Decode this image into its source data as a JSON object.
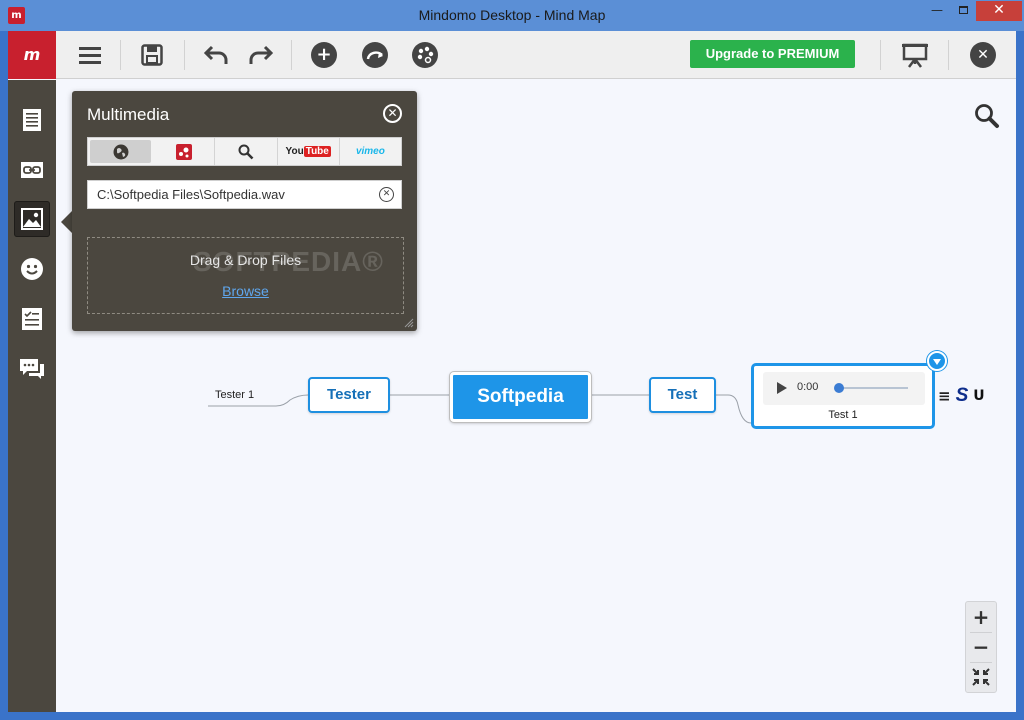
{
  "window": {
    "title": "Mindomo Desktop - Mind Map",
    "minimize": "—",
    "close": "✕"
  },
  "toolbar": {
    "brand_label": "m",
    "upgrade_label": "Upgrade to PREMIUM",
    "buttons": [
      "menu-icon",
      "save-icon",
      "undo-icon",
      "redo-icon",
      "add-topic-icon",
      "relationship-icon",
      "palette-icon",
      "presentation-icon",
      "close-map-icon"
    ],
    "add_label": "+",
    "close_label": "✕"
  },
  "sidebar": {
    "items": [
      "notes-icon",
      "link-icon",
      "image-icon",
      "emoji-icon",
      "tasks-icon",
      "comments-icon"
    ],
    "active": "image-icon"
  },
  "multimedia": {
    "title": "Multimedia",
    "close_label": "✕",
    "tabs": [
      {
        "name": "web-icon",
        "label": ""
      },
      {
        "name": "mindomo-icon",
        "label": ""
      },
      {
        "name": "search-icon",
        "label": ""
      },
      {
        "name": "youtube",
        "label_you": "You",
        "label_tube": "Tube"
      },
      {
        "name": "vimeo",
        "label": "vimeo"
      }
    ],
    "path_value": "C:\\Softpedia Files\\Softpedia.wav",
    "clear_label": "✕",
    "drop_text": "Drag & Drop Files",
    "browse_label": "Browse",
    "watermark": "SOFTPEDIA®"
  },
  "mindmap": {
    "central": "Softpedia",
    "left_child": "Tester",
    "left_leaf": "Tester 1",
    "right_child": "Test",
    "media_time": "0:00",
    "media_label": "Test 1",
    "extras": {
      "notes": "≡",
      "skype": "S",
      "link": "ᑌ"
    }
  },
  "zoom": {
    "in": "+",
    "out": "−",
    "fit": "⤡"
  },
  "colors": {
    "accent": "#1e95e8",
    "brand": "#c8202e",
    "premium": "#2bb24c",
    "sidebar": "#4b473f"
  }
}
